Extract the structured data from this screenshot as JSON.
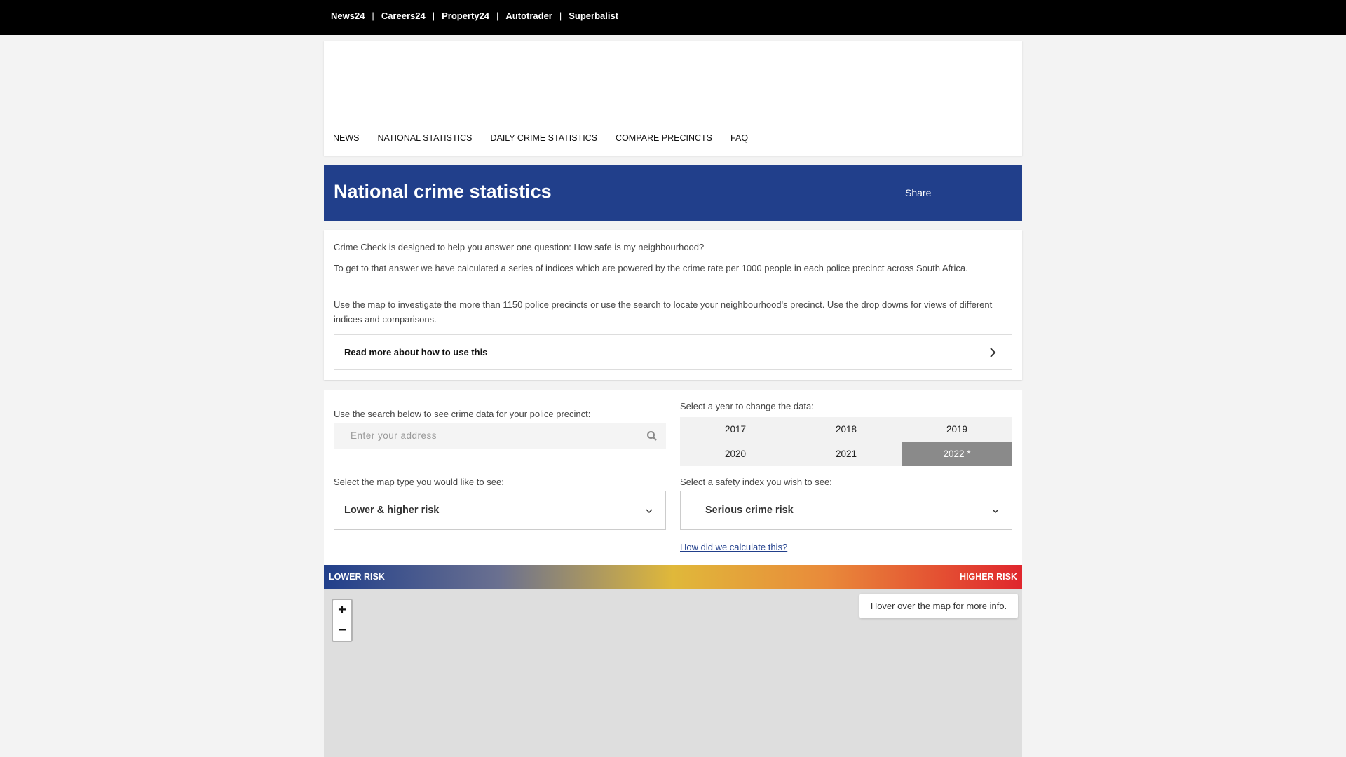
{
  "topbar": {
    "links": [
      "News24",
      "Careers24",
      "Property24",
      "Autotrader",
      "Superbalist"
    ],
    "separator": "|"
  },
  "nav": {
    "items": [
      "NEWS",
      "NATIONAL STATISTICS",
      "DAILY CRIME STATISTICS",
      "COMPARE PRECINCTS",
      "FAQ"
    ]
  },
  "title_bar": {
    "title": "National crime statistics",
    "share": "Share"
  },
  "intro": {
    "p1": "Crime Check is designed to help you answer one question: How safe is my neighbourhood?",
    "p2": "To get to that answer we have calculated a series of indices which are powered by the crime rate per 1000 people in each police precinct across South Africa.",
    "p3": "Use the map to investigate the more than 1150 police precincts or use the search to locate your neighbourhood's precinct. Use the drop downs for views of different indices and comparisons.",
    "read_more": "Read more about how to use this"
  },
  "controls": {
    "search_label": "Use the search below to see crime data for your police precinct:",
    "search_placeholder": "Enter your address",
    "year_label": "Select a year to change the data:",
    "years": [
      "2017",
      "2018",
      "2019",
      "2020",
      "2021",
      "2022 *"
    ],
    "selected_year": "2022 *",
    "map_type_label": "Select the map type you would like to see:",
    "map_type_value": "Lower & higher risk",
    "safety_label": "Select a safety index you wish to see:",
    "safety_value": "Serious crime risk",
    "calc_link": "How did we calculate this?"
  },
  "legend": {
    "low": "LOWER RISK",
    "high": "HIGHER RISK",
    "colors": [
      "#213f8b",
      "#6a7090",
      "#e0b83a",
      "#e98a3a",
      "#e0262d"
    ]
  },
  "map": {
    "zoom_in": "+",
    "zoom_out": "−",
    "hover_info": "Hover over the map for more info."
  }
}
